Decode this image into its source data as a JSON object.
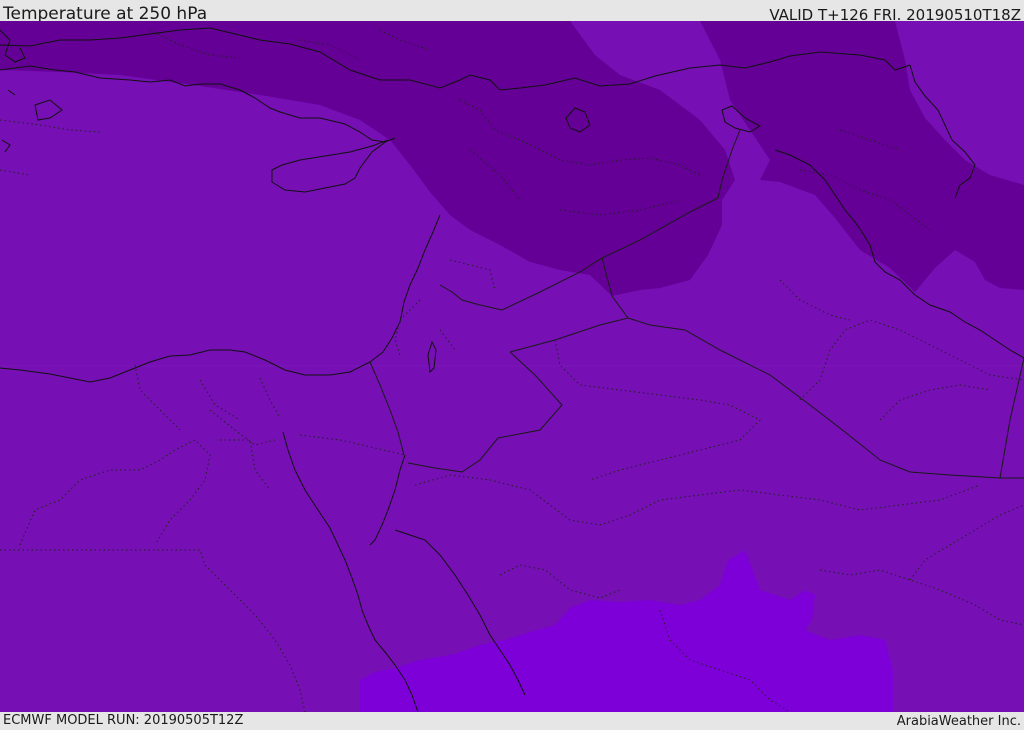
{
  "header": {
    "title": "Temperature at 250 hPa",
    "valid_time": "VALID T+126 FRI. 20190510T18Z"
  },
  "footer": {
    "model_run": "ECMWF MODEL RUN: 20190505T12Z",
    "credit": "ArabiaWeather Inc."
  },
  "map": {
    "variable": "temperature",
    "level": "250 hPa",
    "colors": {
      "base": "#760fb4",
      "cold": "#650096",
      "warm": "#7e00d8",
      "coastline": "#111111",
      "border": "#1a1a1a"
    }
  }
}
